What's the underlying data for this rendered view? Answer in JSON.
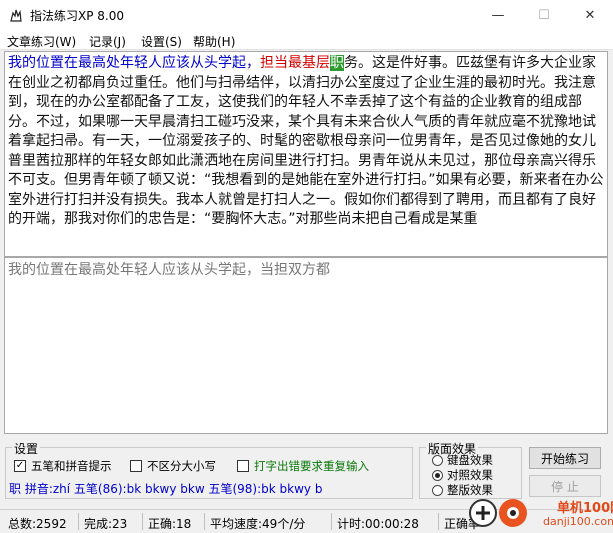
{
  "window": {
    "title": "指法练习XP 8.00",
    "minimize": "—",
    "maximize": "☐",
    "close": "✕"
  },
  "menu": [
    "文章练习(W)",
    "记录(J)",
    "设置(S)",
    "帮助(H)"
  ],
  "reference": {
    "typed_correct": "我的位置在最高处年轻人应该从头学起，",
    "typed_wrong": "担当最基层",
    "current_char": "职",
    "rest": "务。这是件好事。匹兹堡有许多大企业家在创业之初都肩负过重任。他们与扫帚结伴，以清扫办公室度过了企业生涯的最初时光。我注意到，现在的办公室都配备了工友，这使我们的年轻人不幸丢掉了这个有益的企业教育的组成部分。不过，如果哪一天早晨清扫工碰巧没来，某个具有未来合伙人气质的青年就应毫不犹豫地试着拿起扫帚。有一天，一位溺爱孩子的、时髦的密歇根母亲问一位男青年，是否见过像她的女儿普里茜拉那样的年轻女郎如此潇洒地在房间里进行打扫。男青年说从未见过，那位母亲高兴得乐不可支。但男青年顿了顿又说：“我想看到的是她能在室外进行打扫。”如果有必要，新来者在办公室外进行打扫并没有损失。我本人就曾是打扫人之一。假如你们都得到了聘用，而且都有了良好的开端，那我对你们的忠告是：“要胸怀大志。”对那些尚未把自己看成是某重"
  },
  "input": {
    "text": "我的位置在最高处年轻人应该从头学起，当担双方都"
  },
  "settings": {
    "title": "设置",
    "opt1": "五笔和拼音提示",
    "opt1_checked": true,
    "opt2": "不区分大小写",
    "opt2_checked": false,
    "opt3": "打字出错要求重复输入",
    "opt3_checked": false,
    "hint": "职 拼音:zhí 五笔(86):bk bkwy bkw 五笔(98):bk bkwy b"
  },
  "layout": {
    "title": "版面效果",
    "options": [
      "键盘效果",
      "对照效果",
      "整版效果"
    ],
    "selected_index": 1
  },
  "buttons": {
    "start": "开始练习",
    "stop": "停 止"
  },
  "status": {
    "total": "总数:2592",
    "done": "完成:23",
    "correct": "正确:18",
    "speed": "平均速度:49个/分",
    "timer": "计时:00:00:28",
    "rate": "正确率"
  },
  "watermark": {
    "site_cn": "单机100网",
    "site_url": "danji100.com"
  },
  "colors": {
    "typed": "#0000cc",
    "wrong": "#d40000",
    "cursor_bg": "#2e9a2e"
  }
}
